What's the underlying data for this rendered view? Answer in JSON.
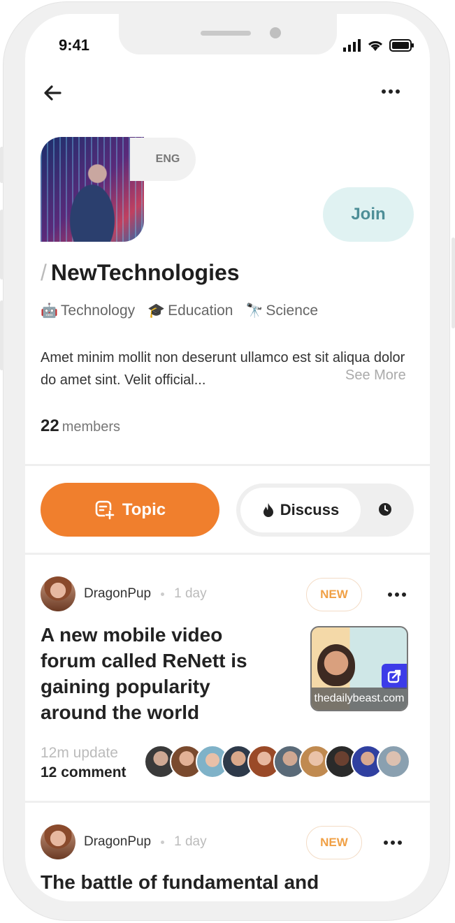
{
  "status_bar": {
    "time": "9:41"
  },
  "community": {
    "language": "ENG",
    "join_label": "Join",
    "name": "NewTechnologies",
    "tags": [
      {
        "icon": "robot-icon",
        "label": "Technology"
      },
      {
        "icon": "graduation-cap-icon",
        "label": "Education"
      },
      {
        "icon": "telescope-icon",
        "label": "Science"
      }
    ],
    "description": "Amet minim mollit non deserunt ullamco est sit aliqua dolor do amet sint. Velit official...",
    "see_more": "See More",
    "member_count": "22",
    "member_label": "members"
  },
  "actions": {
    "topic_label": "Topic",
    "discuss_label": "Discuss"
  },
  "posts": [
    {
      "author": "DragonPup",
      "time": "1 day",
      "badge": "NEW",
      "title": "A new mobile video forum called ReNett is gaining popularity around the world",
      "thumb_domain": "thedailybeast.com",
      "update": "12m update",
      "comments": "12 comment"
    },
    {
      "author": "DragonPup",
      "time": "1 day",
      "badge": "NEW",
      "title": "The battle of fundamental and"
    }
  ],
  "colors": {
    "accent": "#f07f2d",
    "join_bg": "#e0f2f2",
    "join_text": "#4d8e97",
    "badge": "#f0a045"
  }
}
